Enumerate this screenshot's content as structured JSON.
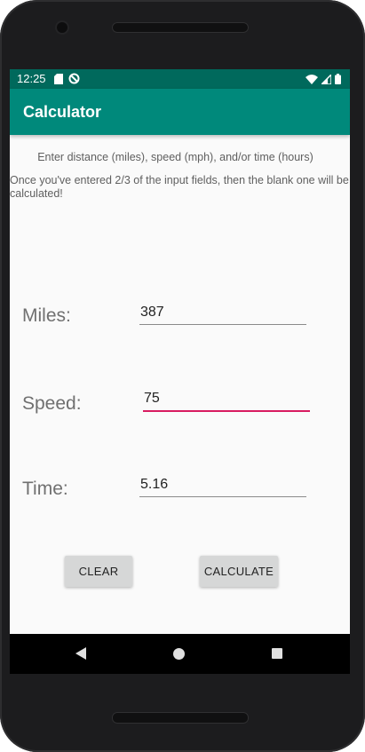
{
  "status_bar": {
    "time": "12:25",
    "icons_left": [
      "sd-card-icon",
      "no-sync-icon"
    ],
    "icons_right": [
      "wifi-icon",
      "signal-icon",
      "battery-icon"
    ]
  },
  "app_bar": {
    "title": "Calculator"
  },
  "instructions": {
    "prompt": "Enter distance (miles), speed (mph), and/or time (hours)",
    "note": "Once you've entered 2/3 of the input fields, then the blank one will be calculated!"
  },
  "fields": {
    "miles": {
      "label": "Miles:",
      "value": "387"
    },
    "speed": {
      "label": "Speed:",
      "value": "75",
      "focused": true
    },
    "time": {
      "label": "Time:",
      "value": "5.16"
    }
  },
  "buttons": {
    "clear": "CLEAR",
    "calculate": "CALCULATE"
  },
  "colors": {
    "status_bar": "#00695c",
    "app_bar": "#00897b",
    "focus_underline": "#d81b60",
    "background": "#fafafa"
  },
  "nav": [
    "back-icon",
    "home-icon",
    "recents-icon"
  ]
}
